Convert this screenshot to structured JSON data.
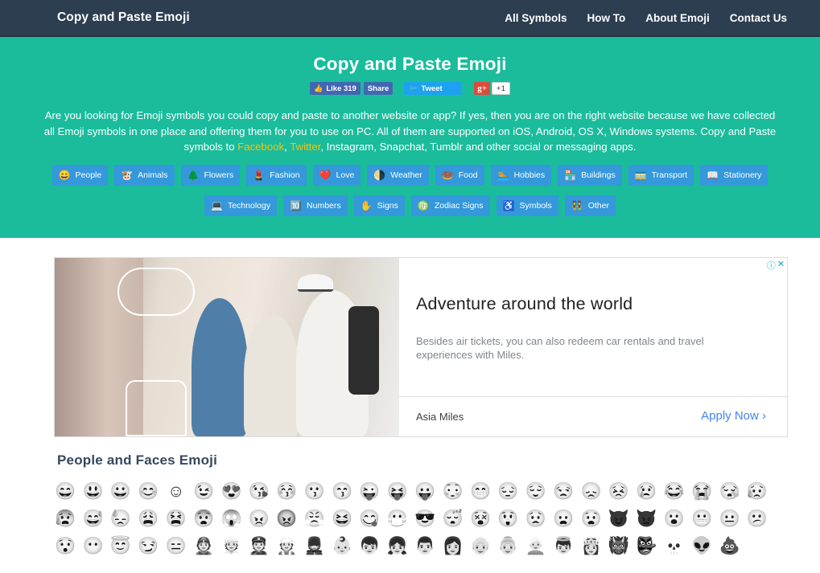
{
  "navbar": {
    "brand": "Copy and Paste Emoji",
    "links": [
      "All Symbols",
      "How To",
      "About Emoji",
      "Contact Us"
    ]
  },
  "hero": {
    "title": "Copy and Paste Emoji",
    "social": {
      "fb_like": "Like 319",
      "fb_share": "Share",
      "tweet": "Tweet",
      "gplus_icon": "g+",
      "gplus_count": "+1"
    },
    "intro_part1": "Are you looking for Emoji symbols you could copy and paste to another website or app? If yes, then you are on the right website because we have collected all Emoji symbols in one place and offering them for you to use on PC. All of them are supported on iOS, Android, OS X, Windows systems. Copy and Paste symbols to ",
    "intro_link1": "Facebook",
    "intro_sep": ", ",
    "intro_link2": "Twitter",
    "intro_part2": ", Instagram, Snapchat, Tumblr and other social or messaging apps.",
    "colors": {
      "accent_link": "#f1c40f",
      "hero_bg": "#1abc9c",
      "button_bg": "#3498db",
      "nav_bg": "#2c3e50"
    },
    "categories": [
      {
        "icon": "😄",
        "label": "People"
      },
      {
        "icon": "🐮",
        "label": "Animals"
      },
      {
        "icon": "🌲",
        "label": "Flowers"
      },
      {
        "icon": "💄",
        "label": "Fashion"
      },
      {
        "icon": "❤️",
        "label": "Love"
      },
      {
        "icon": "🌗",
        "label": "Weather"
      },
      {
        "icon": "🍩",
        "label": "Food"
      },
      {
        "icon": "🏊",
        "label": "Hobbies"
      },
      {
        "icon": "🏪",
        "label": "Buildings"
      },
      {
        "icon": "🚃",
        "label": "Transport"
      },
      {
        "icon": "📖",
        "label": "Stationery"
      },
      {
        "icon": "💻",
        "label": "Technology"
      },
      {
        "icon": "🔟",
        "label": "Numbers"
      },
      {
        "icon": "✋",
        "label": "Signs"
      },
      {
        "icon": "♍",
        "label": "Zodiac Signs"
      },
      {
        "icon": "♿",
        "label": "Symbols"
      },
      {
        "icon": "👯",
        "label": "Other"
      }
    ]
  },
  "ad": {
    "title": "Adventure around the world",
    "description": "Besides air tickets, you can also redeem car rentals and travel experiences with Miles.",
    "advertiser": "Asia Miles",
    "cta": "Apply Now",
    "cta_icon": "›",
    "info_icon": "ⓘ",
    "close_icon": "✕"
  },
  "section": {
    "title": "People and Faces Emoji",
    "emojis": [
      "😄",
      "😃",
      "😀",
      "😊",
      "☺",
      "😉",
      "😍",
      "😘",
      "😚",
      "😗",
      "😙",
      "😜",
      "😝",
      "😛",
      "😳",
      "😁",
      "😔",
      "😌",
      "😒",
      "😞",
      "😣",
      "😢",
      "😂",
      "😭",
      "😪",
      "😥",
      "😰",
      "😅",
      "😓",
      "😩",
      "😫",
      "😨",
      "😱",
      "😠",
      "😡",
      "😤",
      "😆",
      "😋",
      "😷",
      "😎",
      "😴",
      "😵",
      "😲",
      "😟",
      "😦",
      "😧",
      "😈",
      "👿",
      "😮",
      "😬",
      "😐",
      "😕",
      "😯",
      "😶",
      "😇",
      "😏",
      "😑",
      "👲",
      "👳",
      "👮",
      "👷",
      "💂",
      "👶",
      "👦",
      "👧",
      "👨",
      "👩",
      "👴",
      "👵",
      "👱",
      "👼",
      "👸",
      "👹",
      "👺",
      "💀",
      "👽",
      "💩"
    ]
  }
}
